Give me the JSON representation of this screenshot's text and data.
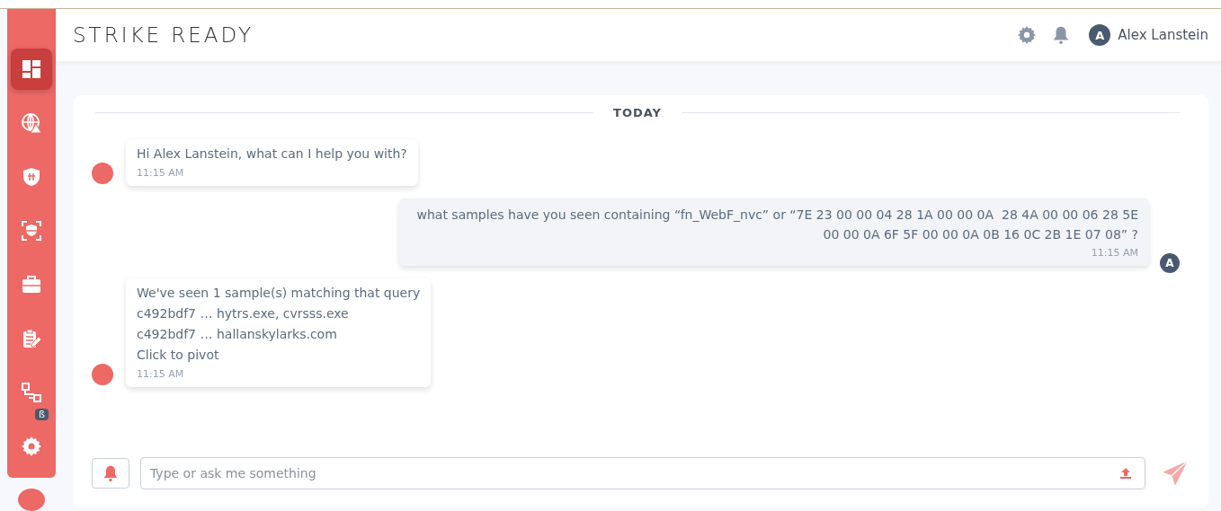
{
  "header": {
    "logo": "STRIKE READY",
    "user": {
      "initial": "A",
      "name": "Alex Lanstein"
    }
  },
  "sidebar": {
    "items": [
      {
        "kind": "dashboard",
        "selected": true
      },
      {
        "kind": "globe",
        "selected": false
      },
      {
        "kind": "shield",
        "selected": false
      },
      {
        "kind": "scan",
        "selected": false
      },
      {
        "kind": "briefcase",
        "selected": false
      },
      {
        "kind": "clipboard",
        "selected": false
      },
      {
        "kind": "flow",
        "selected": false,
        "badge": "ß"
      },
      {
        "kind": "settings",
        "selected": false
      }
    ]
  },
  "chat": {
    "divider": "TODAY",
    "messages": [
      {
        "kind": "bot",
        "lines": [
          "Hi Alex Lanstein, what can I help you with?"
        ],
        "time": "11:15 AM"
      },
      {
        "kind": "user",
        "avatar": "A",
        "lines": [
          "what samples have you seen containing “fn_WebF_nvc” or “7E 23 00 00 04 28 1A 00 00 0A  28 4A 00 00 06 28 5E",
          "00 00 0A 6F 5F 00 00 0A 0B 16 0C 2B 1E 07 08” ?"
        ],
        "time": "11:15 AM"
      },
      {
        "kind": "bot",
        "lines": [
          "We've seen 1 sample(s) matching that query",
          "c492bdf7 … hytrs.exe, cvrsss.exe",
          "c492bdf7 … hallanskylarks.com",
          "Click to pivot"
        ],
        "time": "11:15 AM"
      }
    ],
    "input": {
      "placeholder": "Type or ask me something"
    }
  }
}
